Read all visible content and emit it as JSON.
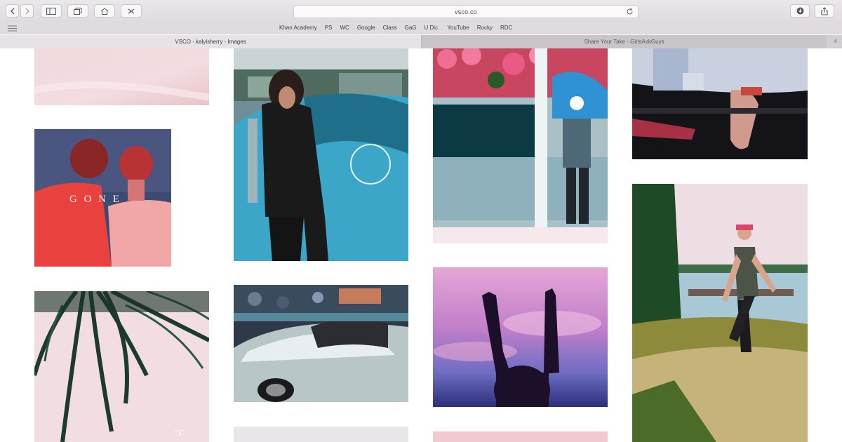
{
  "browser": {
    "url": "vsco.co",
    "favorites": [
      "Khan Academy",
      "PS",
      "WC",
      "Google",
      "Class",
      "GaG",
      "U Dic.",
      "YouTube",
      "Rocky",
      "RDC"
    ],
    "tabs": [
      {
        "label": "VSCO - kalyisherry - Images",
        "active": true
      },
      {
        "label": "Share Your Take - GirlsAskGuys",
        "active": false
      }
    ],
    "new_tab_label": "+"
  },
  "gallery": {
    "overlay_text_gone": "G O N E",
    "overlay_text_partial": "°F"
  },
  "colors": {
    "chrome": "#e6e2e6",
    "accent_pink": "#f2c9d0"
  }
}
